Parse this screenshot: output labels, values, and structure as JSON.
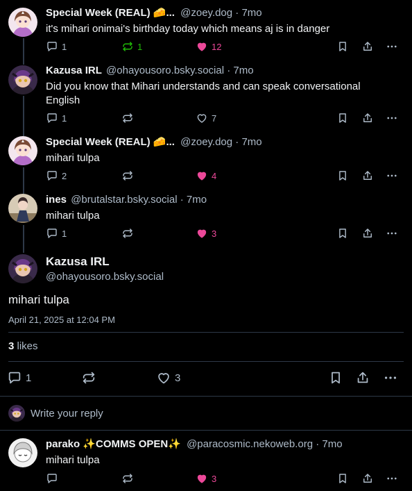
{
  "posts": [
    {
      "name": "Special Week (REAL) 🧀...",
      "handle": "@zoey.dog",
      "sep": "·",
      "time": "7mo",
      "text": "it's mihari onimai's birthday today which means aj is in danger",
      "replies": "1",
      "reposts": "1",
      "likes": "12"
    },
    {
      "name": "Kazusa IRL",
      "handle": "@ohayousoro.bsky.social",
      "sep": "·",
      "time": "7mo",
      "text": "Did you know that Mihari understands and can speak conversational English",
      "replies": "1",
      "reposts": "",
      "likes": "7"
    },
    {
      "name": "Special Week (REAL) 🧀...",
      "handle": "@zoey.dog",
      "sep": "·",
      "time": "7mo",
      "text": "mihari tulpa",
      "replies": "2",
      "reposts": "",
      "likes": "4"
    },
    {
      "name": "ines",
      "handle": "@brutalstar.bsky.social",
      "sep": "·",
      "time": "7mo",
      "text": "mihari tulpa",
      "replies": "1",
      "reposts": "",
      "likes": "3"
    }
  ],
  "focus": {
    "name": "Kazusa IRL",
    "handle": "@ohayousoro.bsky.social",
    "text": "mihari tulpa",
    "date": "April 21, 2025 at 12:04 PM",
    "likes_count": "3",
    "likes_word": "likes",
    "replies": "1",
    "likes": "3"
  },
  "reply_box": {
    "placeholder": "Write your reply"
  },
  "reply_post": {
    "name": "parako ✨COMMS OPEN✨",
    "handle": "@paracosmic.nekoweb.org",
    "sep": "·",
    "time": "7mo",
    "text": "mihari tulpa",
    "likes": "3"
  },
  "colors": {
    "background": "#000000",
    "text": "#f1f3f5",
    "muted": "#aebbc9",
    "repost_active": "#20bc07",
    "like_active": "#ec4899",
    "divider": "#2e3948"
  }
}
